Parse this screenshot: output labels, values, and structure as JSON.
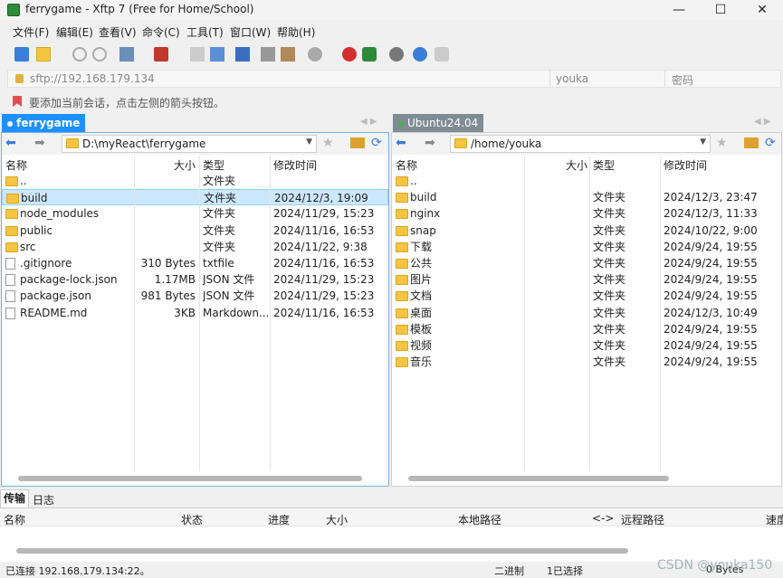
{
  "window": {
    "title": "ferrygame - Xftp 7 (Free for Home/School)",
    "min": "—",
    "max": "☐",
    "close": "✕"
  },
  "menu": [
    "文件(F)",
    "编辑(E)",
    "查看(V)",
    "命令(C)",
    "工具(T)",
    "窗口(W)",
    "帮助(H)"
  ],
  "address": {
    "url": "sftp://192.168.179.134",
    "user": "youka",
    "password_placeholder": "密码"
  },
  "hint": "要添加当前会话，点击左侧的箭头按钮。",
  "left": {
    "tab": "ferrygame",
    "path": "D:\\myReact\\ferrygame",
    "cols": {
      "name": "名称",
      "size": "大小",
      "type": "类型",
      "mtime": "修改时间"
    },
    "rows": [
      {
        "name": "..",
        "size": "",
        "type": "文件夹",
        "mtime": "",
        "kind": "folder"
      },
      {
        "name": "build",
        "size": "",
        "type": "文件夹",
        "mtime": "2024/12/3, 19:09",
        "kind": "folder",
        "selected": true
      },
      {
        "name": "node_modules",
        "size": "",
        "type": "文件夹",
        "mtime": "2024/11/29, 15:23",
        "kind": "folder"
      },
      {
        "name": "public",
        "size": "",
        "type": "文件夹",
        "mtime": "2024/11/16, 16:53",
        "kind": "folder"
      },
      {
        "name": "src",
        "size": "",
        "type": "文件夹",
        "mtime": "2024/11/22, 9:38",
        "kind": "folder"
      },
      {
        "name": ".gitignore",
        "size": "310 Bytes",
        "type": "txtfile",
        "mtime": "2024/11/16, 16:53",
        "kind": "file"
      },
      {
        "name": "package-lock.json",
        "size": "1.17MB",
        "type": "JSON 文件",
        "mtime": "2024/11/29, 15:23",
        "kind": "file"
      },
      {
        "name": "package.json",
        "size": "981 Bytes",
        "type": "JSON 文件",
        "mtime": "2024/11/29, 15:23",
        "kind": "file"
      },
      {
        "name": "README.md",
        "size": "3KB",
        "type": "Markdown...",
        "mtime": "2024/11/16, 16:53",
        "kind": "file"
      }
    ]
  },
  "right": {
    "tab": "Ubuntu24.04",
    "path": "/home/youka",
    "cols": {
      "name": "名称",
      "size": "大小",
      "type": "类型",
      "mtime": "修改时间"
    },
    "rows": [
      {
        "name": "..",
        "type": "",
        "mtime": ""
      },
      {
        "name": "build",
        "type": "文件夹",
        "mtime": "2024/12/3, 23:47"
      },
      {
        "name": "nginx",
        "type": "文件夹",
        "mtime": "2024/12/3, 11:33"
      },
      {
        "name": "snap",
        "type": "文件夹",
        "mtime": "2024/10/22, 9:00"
      },
      {
        "name": "下载",
        "type": "文件夹",
        "mtime": "2024/9/24, 19:55"
      },
      {
        "name": "公共",
        "type": "文件夹",
        "mtime": "2024/9/24, 19:55"
      },
      {
        "name": "图片",
        "type": "文件夹",
        "mtime": "2024/9/24, 19:55"
      },
      {
        "name": "文档",
        "type": "文件夹",
        "mtime": "2024/9/24, 19:55"
      },
      {
        "name": "桌面",
        "type": "文件夹",
        "mtime": "2024/12/3, 10:49"
      },
      {
        "name": "模板",
        "type": "文件夹",
        "mtime": "2024/9/24, 19:55"
      },
      {
        "name": "视频",
        "type": "文件夹",
        "mtime": "2024/9/24, 19:55"
      },
      {
        "name": "音乐",
        "type": "文件夹",
        "mtime": "2024/9/24, 19:55"
      }
    ]
  },
  "transfer": {
    "tabs": [
      "传输",
      "日志"
    ],
    "cols": [
      "名称",
      "状态",
      "进度",
      "大小",
      "本地路径",
      "<->",
      "远程路径",
      "速度"
    ]
  },
  "status": {
    "connected": "已连接 192.168.179.134:22。",
    "mode": "二进制",
    "selected": "1已选择",
    "size": "0 Bytes",
    "watermark": "CSDN @youka150"
  }
}
